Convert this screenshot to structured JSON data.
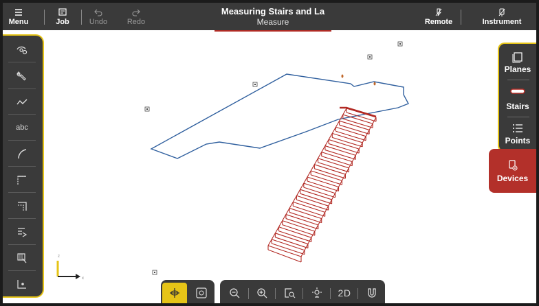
{
  "topbar": {
    "menu_label": "Menu",
    "job_label": "Job",
    "undo_label": "Undo",
    "redo_label": "Redo",
    "title": "Measuring Stairs and La",
    "subtitle": "Measure",
    "remote_label": "Remote",
    "instrument_label": "Instrument"
  },
  "left_toolbar": {
    "text_tool_label": "abc"
  },
  "right_panel": {
    "planes_label": "Planes",
    "stairs_label": "Stairs",
    "points_label": "Points",
    "devices_label": "Devices"
  },
  "bottom_toolbar": {
    "view_2d_label": "2D"
  },
  "axis": {
    "z_label": "z",
    "x_label": "x"
  },
  "colors": {
    "accent_yellow": "#e6c417",
    "devices_red": "#b3302a",
    "plan_outline_blue": "#2f5f9e",
    "stairs_red": "#b22a24",
    "toolbar_dark": "#3a3a3a"
  }
}
